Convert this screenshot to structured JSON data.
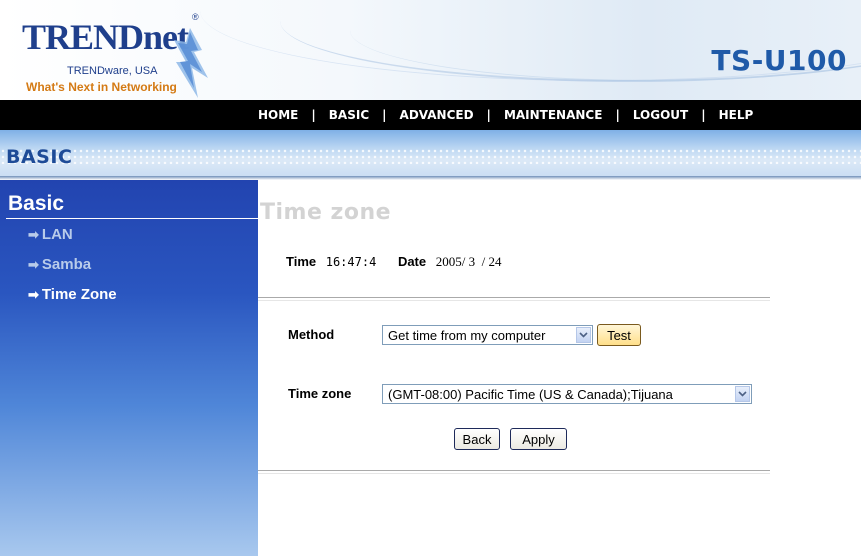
{
  "header": {
    "logo_word": "TRENDnet",
    "logo_reg": "®",
    "logo_subtitle": "TRENDware, USA",
    "logo_tagline": "What's Next in Networking",
    "model": "TS-U100"
  },
  "nav": {
    "items": [
      "HOME",
      "BASIC",
      "ADVANCED",
      "MAINTENANCE",
      "LOGOUT",
      "HELP"
    ],
    "separator": "|"
  },
  "section": {
    "title": "BASIC"
  },
  "sidebar": {
    "title": "Basic",
    "items": [
      {
        "label": "LAN",
        "active": false
      },
      {
        "label": "Samba",
        "active": false
      },
      {
        "label": "Time Zone",
        "active": true
      }
    ],
    "arrow": "➡"
  },
  "main": {
    "title": "Time zone",
    "time_label": "Time",
    "time_value": "16:47:4",
    "date_label": "Date",
    "date_value": "2005/ 3  / 24",
    "method_label": "Method",
    "method_value": "Get time from my computer",
    "test_label": "Test",
    "timezone_label": "Time zone",
    "timezone_value": "(GMT-08:00) Pacific Time (US & Canada);Tijuana",
    "back_label": "Back",
    "apply_label": "Apply"
  },
  "colors": {
    "nav_bg": "#000000",
    "sidebar_top": "#2244b0",
    "brand_blue": "#1f3f8c",
    "model_blue": "#1f5aa8",
    "tagline_orange": "#d47a14"
  },
  "icons": {
    "sidebar_arrow": "right-arrow-icon",
    "dropdown": "chevron-down-icon"
  }
}
